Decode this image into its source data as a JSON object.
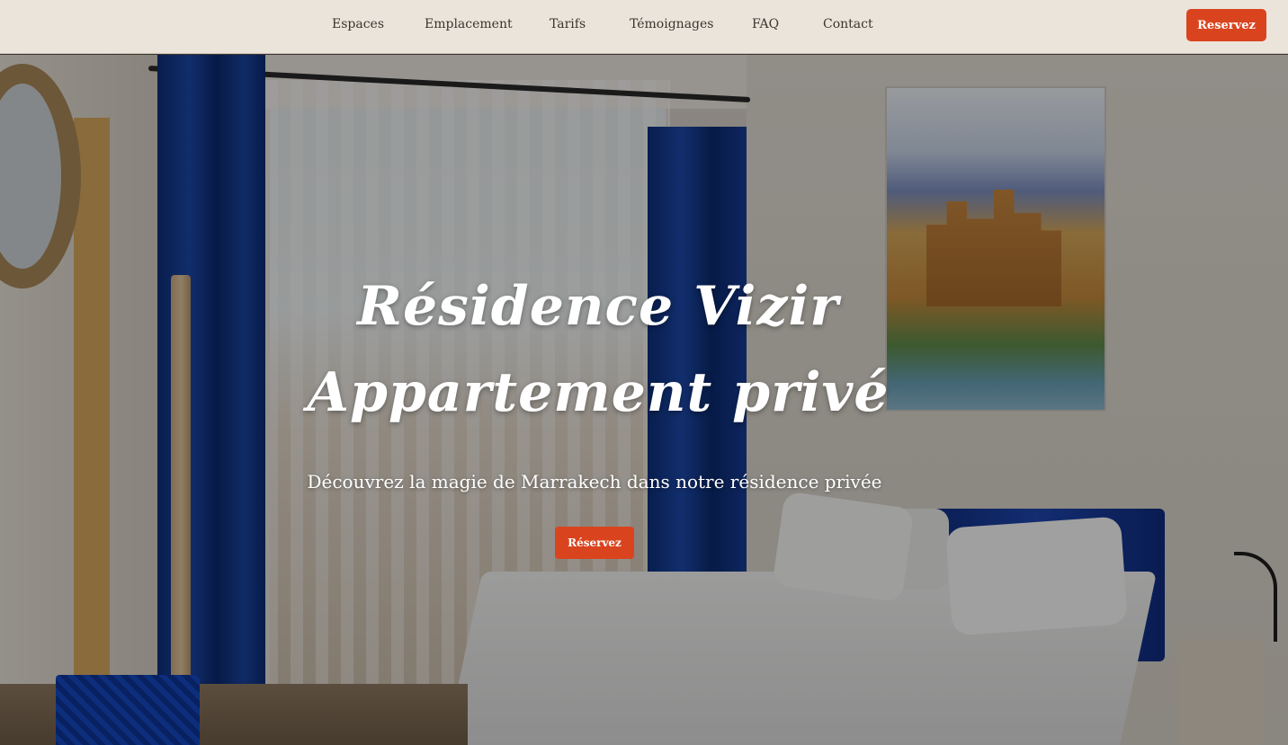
{
  "nav": {
    "links": [
      "Espaces",
      "Emplacement",
      "Tarifs",
      "Témoignages",
      "FAQ",
      "Contact"
    ],
    "cta_label": "Reservez"
  },
  "hero": {
    "title_line1": "Résidence Vizir",
    "title_line2": "Appartement privé",
    "subtitle": "Découvrez la magie de Marrakech dans notre résidence privée",
    "cta_label": "Réservez",
    "background": "bedroom-photo"
  },
  "colors": {
    "nav_background": "#ebe4db",
    "accent": "#d9441f",
    "nav_text": "#3b352e",
    "hero_text": "#ffffff"
  }
}
